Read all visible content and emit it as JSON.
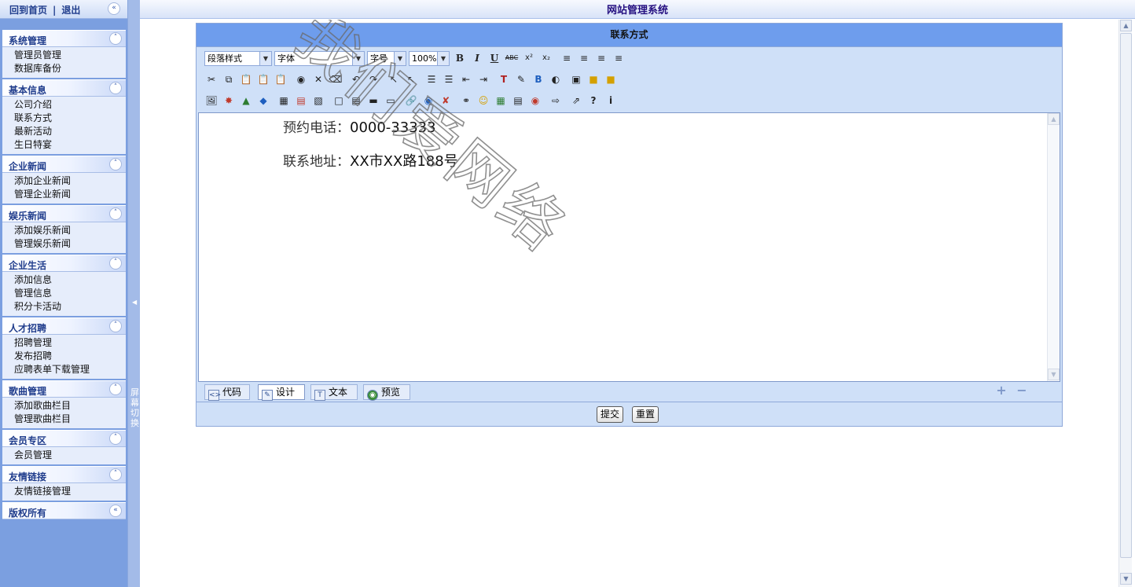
{
  "nav": {
    "home": "回到首页",
    "separator": "|",
    "logout": "退出"
  },
  "app_title": "网站管理系统",
  "splitter": {
    "label": "屏幕切换"
  },
  "menu": [
    {
      "title": "系统管理",
      "items": [
        "管理员管理",
        "数据库备份"
      ]
    },
    {
      "title": "基本信息",
      "items": [
        "公司介绍",
        "联系方式",
        "最新活动",
        "生日特宴"
      ]
    },
    {
      "title": "企业新闻",
      "items": [
        "添加企业新闻",
        "管理企业新闻"
      ]
    },
    {
      "title": "娱乐新闻",
      "items": [
        "添加娱乐新闻",
        "管理娱乐新闻"
      ]
    },
    {
      "title": "企业生活",
      "items": [
        "添加信息",
        "管理信息",
        "积分卡活动"
      ]
    },
    {
      "title": "人才招聘",
      "items": [
        "招聘管理",
        "发布招聘",
        "应聘表单下载管理"
      ]
    },
    {
      "title": "歌曲管理",
      "items": [
        "添加歌曲栏目",
        "管理歌曲栏目"
      ]
    },
    {
      "title": "会员专区",
      "items": [
        "会员管理"
      ]
    },
    {
      "title": "友情链接",
      "items": [
        "友情链接管理"
      ]
    },
    {
      "title": "版权所有",
      "items": []
    }
  ],
  "panel_title": "联系方式",
  "toolbar": {
    "paragraph_style": "段落样式",
    "font": "字体",
    "font_size": "字号",
    "zoom": "100%",
    "bold": "B",
    "italic": "I",
    "underline": "U",
    "strike": "ABC",
    "superscript": "x²",
    "subscript": "x₂"
  },
  "editor": {
    "phone_label": "预约电话：",
    "phone_value": "0000-33333",
    "address_label": "联系地址：",
    "address_value": "XX市XX路188号"
  },
  "mode_tabs": {
    "code": "代码",
    "design": "设计",
    "text": "文本",
    "preview": "预览"
  },
  "buttons": {
    "submit": "提交",
    "reset": "重置"
  },
  "watermark": {
    "text": "我们爱网络"
  }
}
